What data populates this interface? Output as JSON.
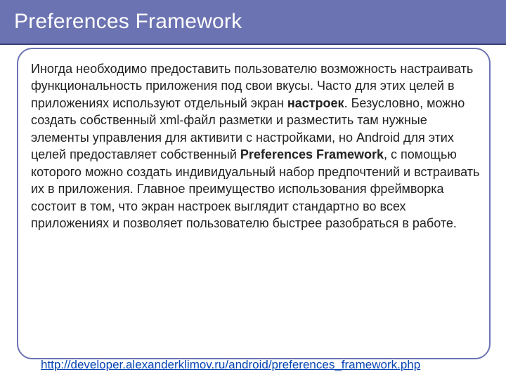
{
  "title": "Preferences Framework",
  "body": {
    "p1a": "Иногда необходимо предоставить пользователю возможность настраивать функциональность приложения под свои вкусы. Часто для этих целей в приложениях используют отдельный экран ",
    "p1b_bold": "настроек",
    "p1c": ". Безусловно, можно создать собственный xml-файл разметки и разместить там нужные элементы управления для активити с настройками, но Android для этих целей предоставляет собственный ",
    "p1d_bold": "Preferences Framework",
    "p1e": ", с помощью которого можно создать индивидуальный набор предпочтений и встраивать их в приложения. Главное преимущество использования фреймворка состоит в том, что экран настроек выглядит стандартно во всех приложениях и позволяет пользователю быстрее разобраться в работе."
  },
  "link_text": "http://developer.alexanderklimov.ru/android/preferences_framework.php"
}
